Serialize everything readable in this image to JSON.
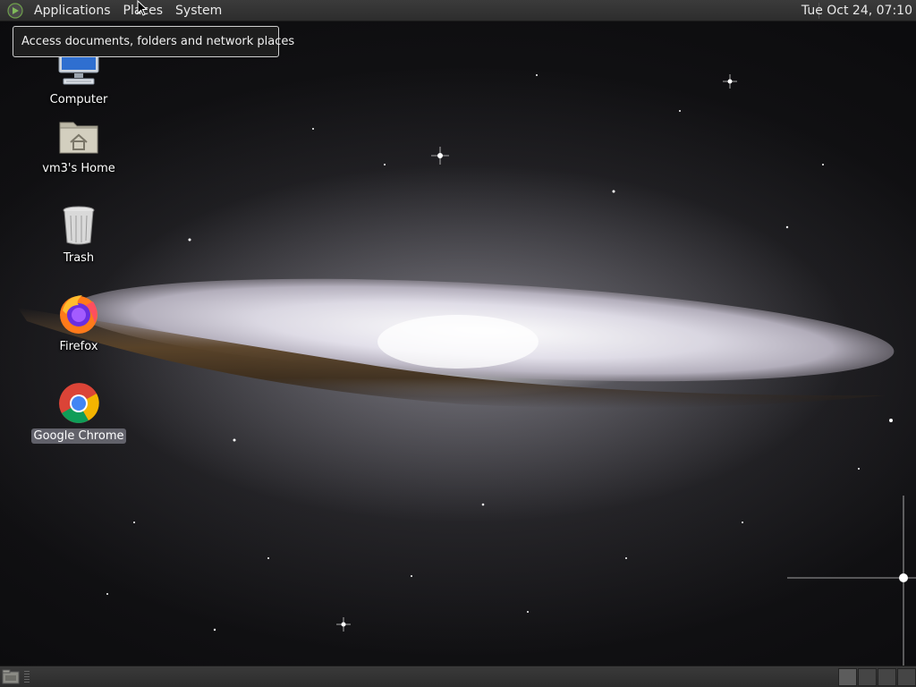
{
  "top_panel": {
    "menus": [
      {
        "label": "Applications"
      },
      {
        "label": "Places"
      },
      {
        "label": "System"
      }
    ],
    "clock": "Tue Oct 24, 07:10"
  },
  "tooltip": {
    "text": "Access documents, folders and network places"
  },
  "desktop": {
    "icons": [
      {
        "label": "Computer",
        "icon": "computer-icon"
      },
      {
        "label": "vm3's Home",
        "icon": "home-folder-icon"
      },
      {
        "label": "Trash",
        "icon": "trash-icon"
      },
      {
        "label": "Firefox",
        "icon": "firefox-icon"
      },
      {
        "label": "Google Chrome",
        "icon": "chrome-icon",
        "selected": true
      }
    ]
  },
  "bottom_panel": {
    "workspaces_active": 1
  },
  "colors": {
    "panel": "#333333",
    "tooltip_bg": "#1e1e1e",
    "selected_label": "#6e6e78"
  }
}
